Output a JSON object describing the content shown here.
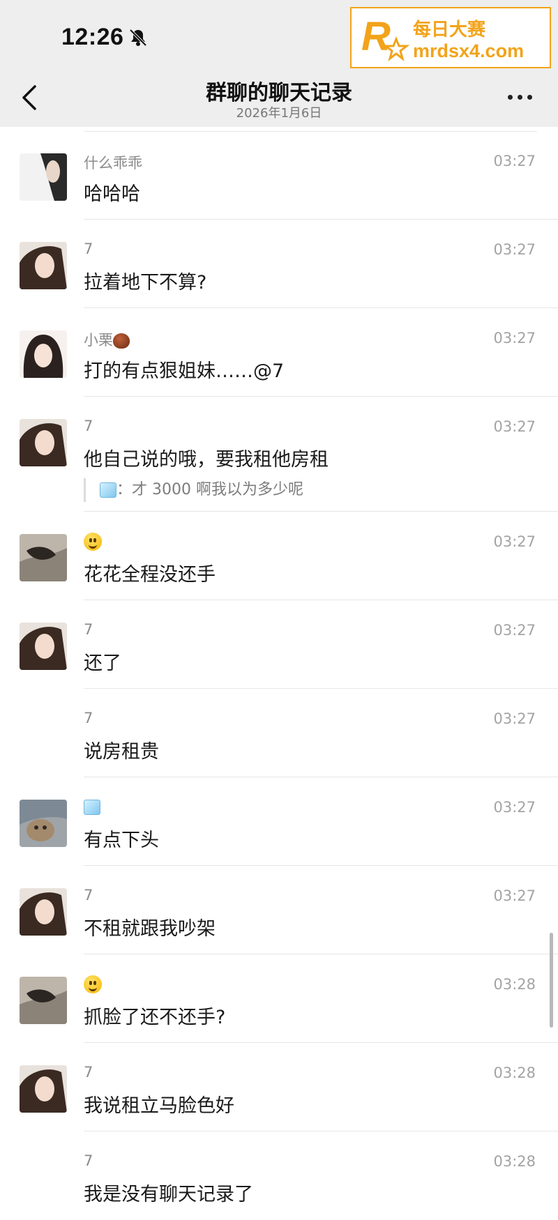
{
  "status_bar": {
    "time": "12:26"
  },
  "watermark": {
    "name": "每日大赛",
    "url": "mrdsx4.com"
  },
  "nav": {
    "title": "群聊的聊天记录",
    "subtitle": "2026年1月6日"
  },
  "messages": [
    {
      "sender": "什么乖乖",
      "time": "03:27",
      "text": "哈哈哈"
    },
    {
      "sender": "7",
      "time": "03:27",
      "text": "拉着地下不算?"
    },
    {
      "sender": "小栗",
      "sender_emoji": "chestnut-emoji",
      "time": "03:27",
      "text": "打的有点狠姐妹……@7"
    },
    {
      "sender": "7",
      "time": "03:27",
      "text": "他自己说的哦，要我租他房租",
      "quote": {
        "sender_emoji": "ice-cube-emoji",
        "text": "：才 3000 啊我以为多少呢"
      }
    },
    {
      "sender": "",
      "sender_emoji": "grinning-face-emoji",
      "time": "03:27",
      "text": "花花全程没还手"
    },
    {
      "sender": "7",
      "time": "03:27",
      "text": "还了"
    },
    {
      "sender": "7",
      "time": "03:27",
      "text": "说房租贵"
    },
    {
      "sender": "",
      "sender_emoji": "ice-cube-emoji",
      "time": "03:27",
      "text": "有点下头"
    },
    {
      "sender": "7",
      "time": "03:27",
      "text": "不租就跟我吵架"
    },
    {
      "sender": "",
      "sender_emoji": "grinning-face-emoji",
      "time": "03:28",
      "text": "抓脸了还不还手?"
    },
    {
      "sender": "7",
      "time": "03:28",
      "text": "我说租立马脸色好"
    },
    {
      "sender": "7",
      "time": "03:28",
      "text": "我是没有聊天记录了"
    }
  ]
}
